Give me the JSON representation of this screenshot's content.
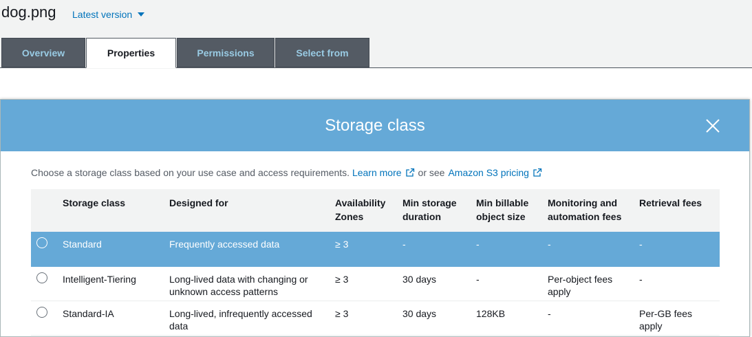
{
  "object": {
    "name": "dog.png",
    "version_label": "Latest version"
  },
  "tabs": [
    {
      "label": "Overview"
    },
    {
      "label": "Properties"
    },
    {
      "label": "Permissions"
    },
    {
      "label": "Select from"
    }
  ],
  "modal": {
    "title": "Storage class",
    "description": "Choose a storage class based on your use case and access requirements.",
    "learn_more": "Learn more",
    "or_see": "or see",
    "pricing_link": "Amazon S3 pricing"
  },
  "table": {
    "headers": {
      "storage_class": "Storage class",
      "designed_for": "Designed for",
      "az_1": "Availability",
      "az_2": "Zones",
      "min_storage_1": "Min storage",
      "min_storage_2": "duration",
      "min_billable_1": "Min billable",
      "min_billable_2": "object size",
      "monitoring_1": "Monitoring and",
      "monitoring_2": "automation fees",
      "retrieval": "Retrieval fees"
    },
    "rows": [
      {
        "storage_class": "Standard",
        "designed_for_1": "Frequently accessed data",
        "designed_for_2": "",
        "az": "≥ 3",
        "min_storage": "-",
        "min_billable": "-",
        "monitoring_1": "-",
        "monitoring_2": "",
        "retrieval_1": "-",
        "retrieval_2": "",
        "selected": true
      },
      {
        "storage_class": "Intelligent-Tiering",
        "designed_for_1": "Long-lived data with changing or",
        "designed_for_2": "unknown access patterns",
        "az": "≥ 3",
        "min_storage": "30 days",
        "min_billable": "-",
        "monitoring_1": "Per-object fees",
        "monitoring_2": "apply",
        "retrieval_1": "-",
        "retrieval_2": "",
        "selected": false
      },
      {
        "storage_class": "Standard-IA",
        "designed_for_1": "Long-lived, infrequently accessed",
        "designed_for_2": "data",
        "az": "≥ 3",
        "min_storage": "30 days",
        "min_billable": "128KB",
        "monitoring_1": "-",
        "monitoring_2": "",
        "retrieval_1": "Per-GB fees",
        "retrieval_2": "apply",
        "selected": false
      }
    ]
  },
  "colors": {
    "accent": "#65a9d7",
    "link": "#0073bb",
    "tab_dark": "#545b64"
  },
  "icons": {
    "close": "close-icon",
    "external_link": "external-link-icon",
    "caret": "caret-down-icon"
  }
}
